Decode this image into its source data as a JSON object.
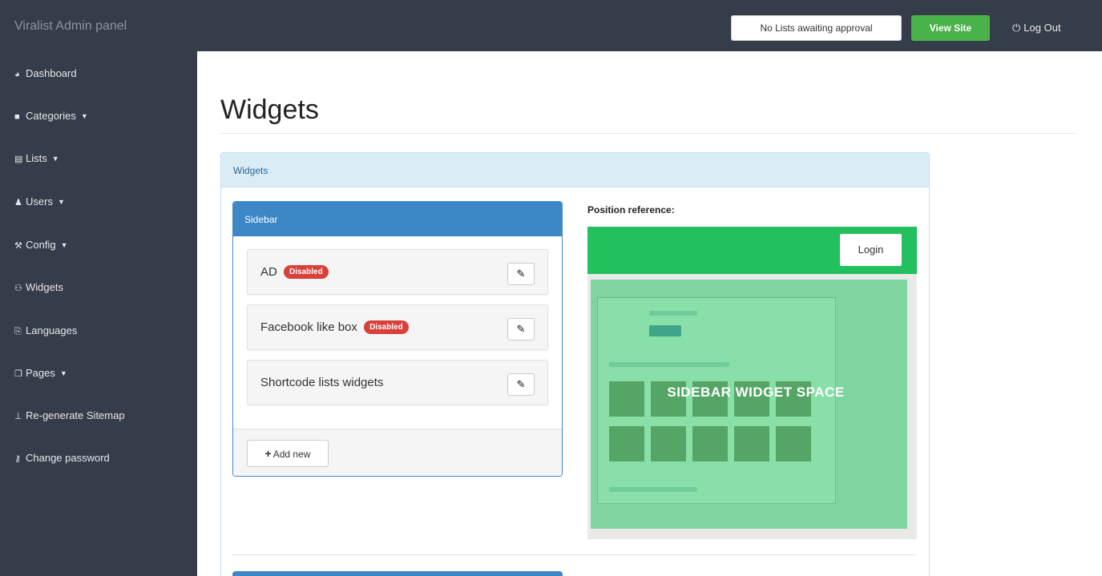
{
  "header": {
    "brand": "Viralist Admin panel",
    "pending_label": "No Lists awaiting approval",
    "view_site_label": "View Site",
    "logout_label": "Log Out"
  },
  "sidebar": {
    "items": [
      {
        "label": "Dashboard",
        "icon": "dashboard-icon"
      },
      {
        "label": "Categories",
        "icon": "folder-icon",
        "dropdown": true
      },
      {
        "label": "Lists",
        "icon": "file-icon",
        "dropdown": true
      },
      {
        "label": "Users",
        "icon": "user-icon",
        "dropdown": true
      },
      {
        "label": "Config",
        "icon": "wrench-icon",
        "dropdown": true
      },
      {
        "label": "Widgets",
        "icon": "sitemap-icon"
      },
      {
        "label": "Languages",
        "icon": "translate-icon"
      },
      {
        "label": "Pages",
        "icon": "pages-icon",
        "dropdown": true
      },
      {
        "label": "Re-generate Sitemap",
        "icon": "sitemap-tree-icon"
      },
      {
        "label": "Change password",
        "icon": "key-icon"
      }
    ]
  },
  "main": {
    "page_title": "Widgets",
    "panel_title": "Widgets",
    "sidebar_box": {
      "title": "Sidebar",
      "widgets": [
        {
          "name": "AD",
          "badge": "Disabled"
        },
        {
          "name": "Facebook like box",
          "badge": "Disabled"
        },
        {
          "name": "Shortcode lists widgets",
          "badge": ""
        }
      ],
      "add_label": "Add new"
    },
    "position_label": "Position reference:",
    "preview": {
      "login_label": "Login",
      "space_label": "SIDEBAR WIDGET SPACE"
    }
  },
  "colors": {
    "nav_bg": "#363d4a",
    "primary": "#3d87c7",
    "success": "#4ab24a",
    "danger": "#d9403b",
    "preview_green": "#22c15e"
  }
}
